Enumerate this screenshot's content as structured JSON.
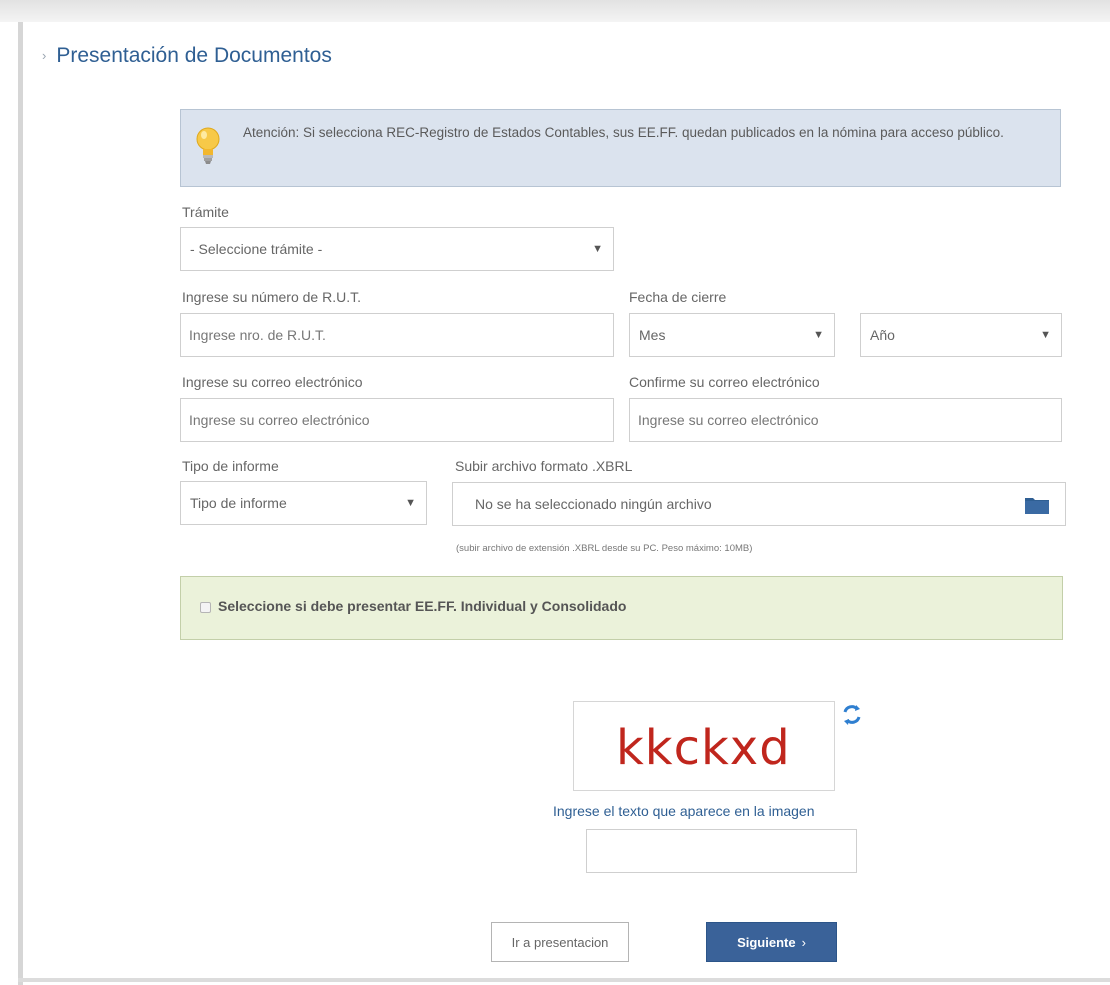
{
  "page": {
    "title": "Presentación de Documentos"
  },
  "notice": {
    "text": "Atención: Si selecciona REC-Registro de Estados Contables, sus EE.FF. quedan publicados en la nómina para acceso público."
  },
  "form": {
    "tramite": {
      "label": "Trámite",
      "value": "- Seleccione trámite -"
    },
    "rut": {
      "label": "Ingrese su número de R.U.T.",
      "placeholder": "Ingrese nro. de R.U.T."
    },
    "fecha_cierre": {
      "label": "Fecha de cierre",
      "month_value": "Mes",
      "year_value": "Año"
    },
    "email": {
      "label": "Ingrese su correo electrónico",
      "placeholder": "Ingrese su correo electrónico"
    },
    "email_confirm": {
      "label": "Confirme su correo electrónico",
      "placeholder": "Ingrese su correo electrónico"
    },
    "tipo_informe": {
      "label": "Tipo de informe",
      "value": "Tipo de informe"
    },
    "file_upload": {
      "label": "Subir archivo formato .XBRL",
      "value": "No se ha seleccionado ningún archivo",
      "hint": "(subir archivo de extensión .XBRL desde su PC. Peso máximo: 10MB)"
    },
    "checkbox": {
      "label": "Seleccione si debe presentar EE.FF. Individual y Consolidado",
      "checked": false
    }
  },
  "captcha": {
    "text": "kkckxd",
    "label": "Ingrese el texto que aparece en la imagen",
    "input_value": ""
  },
  "buttons": {
    "secondary": "Ir a presentacion",
    "primary": "Siguiente",
    "primary_chevron": "›"
  },
  "icons": {
    "heading": "chevron-right-icon",
    "notice": "lightbulb-icon",
    "select_caret": "caret-down-icon",
    "file": "folder-icon",
    "captcha_refresh": "refresh-icon"
  },
  "colors": {
    "accent": "#2f5f93",
    "primary_button": "#3a6299",
    "notice_bg": "#dbe3ee",
    "checkbox_panel_bg": "#ebf2da",
    "captcha_text": "#c0261d"
  }
}
